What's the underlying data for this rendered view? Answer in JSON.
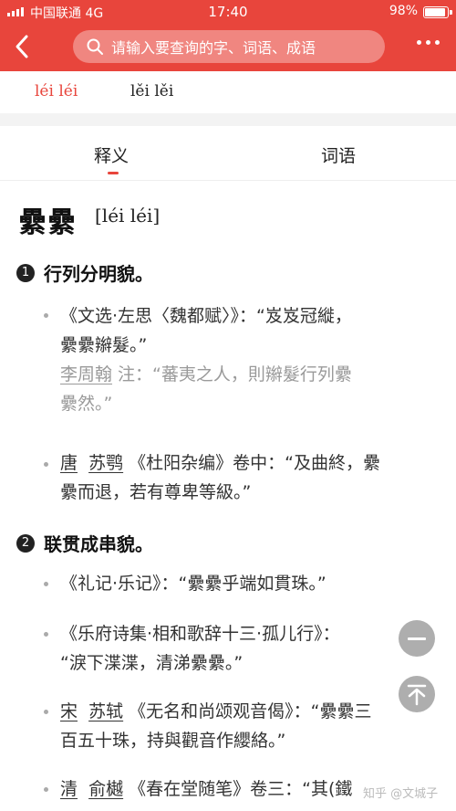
{
  "status": {
    "carrier": "中国联通 4G",
    "time": "17:40",
    "battery": "98%",
    "battery_level": 0.98
  },
  "nav": {
    "search_placeholder": "请输入要查询的字、词语、成语"
  },
  "pinyin_tabs": [
    "léi léi",
    "lěi lěi"
  ],
  "tabs": [
    "释义",
    "词语"
  ],
  "entry": {
    "word": "纍纍",
    "pinyin": "[léi léi]",
    "senses": [
      {
        "num": "1",
        "text": "行列分明貌。",
        "examples": [
          {
            "line1": "《文选·左思〈魏都赋〉》：“岌岌冠縰，",
            "line2": "纍纍辮髮。”",
            "note_author": "李周翰",
            "note_line1": " 注：“蕃夷之人，則辮髮行列纍",
            "note_line2": "纍然。”"
          },
          {
            "author1": "唐",
            "author2": "苏鹗",
            "line1": " 《杜阳杂编》卷中：“及曲終，纍",
            "line2": "纍而退，若有尊卑等級。”"
          }
        ]
      },
      {
        "num": "2",
        "text": "联贯成串貌。",
        "examples": [
          {
            "line1": "《礼记·乐记》：“纍纍乎端如貫珠。”"
          },
          {
            "line1": "《乐府诗集·相和歌辞十三·孤儿行》：",
            "line2": "“淚下渫渫，清涕纍纍。”"
          },
          {
            "author1": "宋",
            "author2": "苏轼",
            "line1": " 《无名和尚颂观音偈》：“纍纍三",
            "line2": "百五十珠，持與觀音作纓絡。”"
          },
          {
            "author1": "清",
            "author2": "俞樾",
            "line1": " 《春在堂随笔》卷三：“其(鐵"
          }
        ]
      }
    ]
  },
  "watermark": "知乎 @文城子",
  "colors": {
    "accent": "#e8453c",
    "fab": "#a8a8a8"
  }
}
